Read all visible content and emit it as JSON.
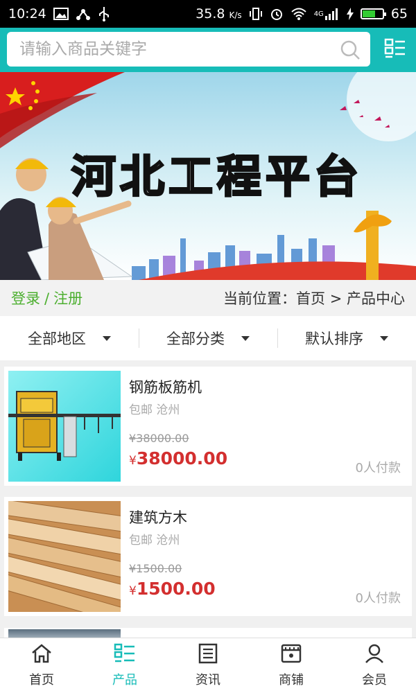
{
  "status_bar": {
    "time": "10:24",
    "speed": "35.8",
    "speed_unit": "K/s",
    "network": "4G",
    "battery": "65",
    "battery_level": 0.65
  },
  "search": {
    "placeholder": "请输入商品关键字",
    "value": ""
  },
  "banner": {
    "title": "河北工程平台"
  },
  "location": {
    "login": "登录",
    "separator": "/",
    "register": "注册",
    "prefix": "当前位置：",
    "home": "首页",
    "arrow": ">",
    "current": "产品中心"
  },
  "filters": [
    {
      "label": "全部地区"
    },
    {
      "label": "全部分类"
    },
    {
      "label": "默认排序"
    }
  ],
  "products": [
    {
      "name": "钢筋板筋机",
      "shipping": "包邮 沧州",
      "original_price": "¥38000.00",
      "currency": "¥",
      "price": "38000.00",
      "buyers": "0人付款"
    },
    {
      "name": "建筑方木",
      "shipping": "包邮 沧州",
      "original_price": "¥1500.00",
      "currency": "¥",
      "price": "1500.00",
      "buyers": "0人付款"
    }
  ],
  "bottom_nav": [
    {
      "label": "首页",
      "icon": "home-icon"
    },
    {
      "label": "产品",
      "icon": "list-icon",
      "active": true
    },
    {
      "label": "资讯",
      "icon": "news-icon"
    },
    {
      "label": "商铺",
      "icon": "store-icon"
    },
    {
      "label": "会员",
      "icon": "user-icon"
    }
  ],
  "colors": {
    "accent": "#17bcb8",
    "price": "#d32f2f",
    "login": "#4caf2f"
  }
}
